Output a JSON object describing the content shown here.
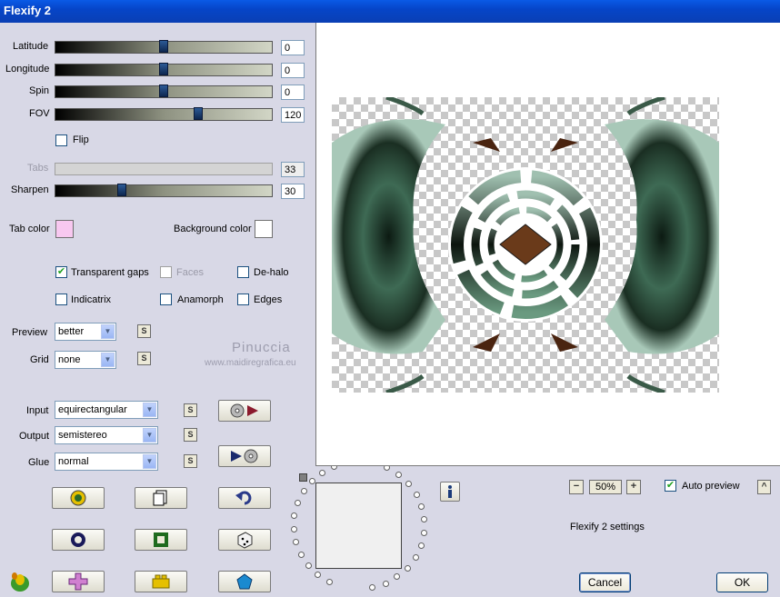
{
  "window": {
    "title": "Flexify 2"
  },
  "sliders": [
    {
      "label": "Latitude",
      "value": "0",
      "fraction": 0.5
    },
    {
      "label": "Longitude",
      "value": "0",
      "fraction": 0.5
    },
    {
      "label": "Spin",
      "value": "0",
      "fraction": 0.5
    },
    {
      "label": "FOV",
      "value": "120",
      "fraction": 0.66
    },
    {
      "label": "Tabs",
      "value": "33",
      "fraction": null,
      "disabled": true
    },
    {
      "label": "Sharpen",
      "value": "30",
      "fraction": 0.3
    }
  ],
  "flip": {
    "label": "Flip",
    "checked": false
  },
  "colors": {
    "tab_label": "Tab color",
    "tab_value": "#f8c8f0",
    "bg_label": "Background color",
    "bg_value": "#ffffff"
  },
  "options": {
    "transparent_gaps": {
      "label": "Transparent gaps",
      "checked": true
    },
    "faces": {
      "label": "Faces",
      "checked": false,
      "disabled": true
    },
    "de_halo": {
      "label": "De-halo",
      "checked": false
    },
    "indicatrix": {
      "label": "Indicatrix",
      "checked": false
    },
    "anamorph": {
      "label": "Anamorph",
      "checked": false
    },
    "edges": {
      "label": "Edges",
      "checked": false
    }
  },
  "preview_select": {
    "label": "Preview",
    "value": "better"
  },
  "grid_select": {
    "label": "Grid",
    "value": "none"
  },
  "input_select": {
    "label": "Input",
    "value": "equirectangular"
  },
  "output_select": {
    "label": "Output",
    "value": "semistereo"
  },
  "glue_select": {
    "label": "Glue",
    "value": "normal"
  },
  "s_button_label": "S",
  "watermark": {
    "name": "Pinuccia",
    "site": "www.maidiregrafica.eu"
  },
  "zoom": {
    "minus": "−",
    "value": "50%",
    "plus": "+"
  },
  "auto_preview": {
    "label": "Auto preview",
    "checked": true
  },
  "collapse_label": "^",
  "settings_label": "Flexify 2 settings",
  "buttons": {
    "cancel": "Cancel",
    "ok": "OK"
  },
  "icons": {
    "play_in": "disc-play-icon",
    "play_out": "play-disc-icon",
    "toolbar": [
      "gear-icon",
      "copy-icon",
      "undo-icon",
      "ring-icon",
      "frame-icon",
      "dice-icon",
      "logo-icon",
      "cross-icon",
      "brick-icon",
      "pentagon-icon"
    ],
    "info": "info-icon"
  }
}
